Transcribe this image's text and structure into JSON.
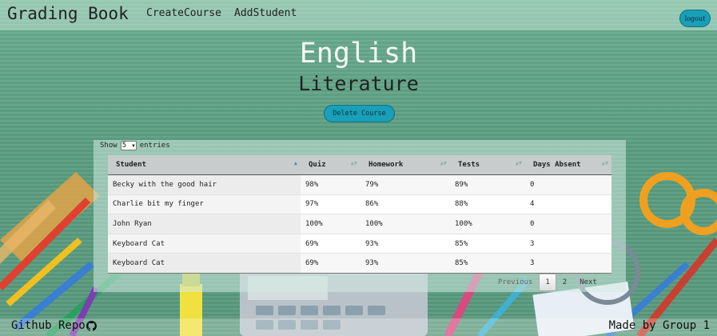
{
  "header": {
    "brand": "Grading Book",
    "nav": [
      "CreateCourse",
      "AddStudent"
    ],
    "logout_label": "logout"
  },
  "course": {
    "title": "English",
    "subtitle": "Literature",
    "delete_label": "Delete Course"
  },
  "table_controls": {
    "show_label": "Show",
    "page_size": "5",
    "entries_label": "entries"
  },
  "table": {
    "columns": [
      "Student",
      "Quiz",
      "Homework",
      "Tests",
      "Days Absent"
    ],
    "rows": [
      [
        "Becky with the good hair",
        "98%",
        "79%",
        "89%",
        "0"
      ],
      [
        "Charlie bit my finger",
        "97%",
        "86%",
        "88%",
        "4"
      ],
      [
        "John Ryan",
        "100%",
        "100%",
        "100%",
        "0"
      ],
      [
        "Keyboard Cat",
        "69%",
        "93%",
        "85%",
        "3"
      ],
      [
        "Keyboard Cat",
        "69%",
        "93%",
        "85%",
        "3"
      ]
    ]
  },
  "pagination": {
    "previous": "Previous",
    "pages": [
      "1",
      "2"
    ],
    "next": "Next"
  },
  "footer": {
    "repo_label": "Github Repo",
    "credit": "Made by Group 1"
  },
  "colors": {
    "button": "#1a9fb8",
    "board": "#5e9f83"
  }
}
